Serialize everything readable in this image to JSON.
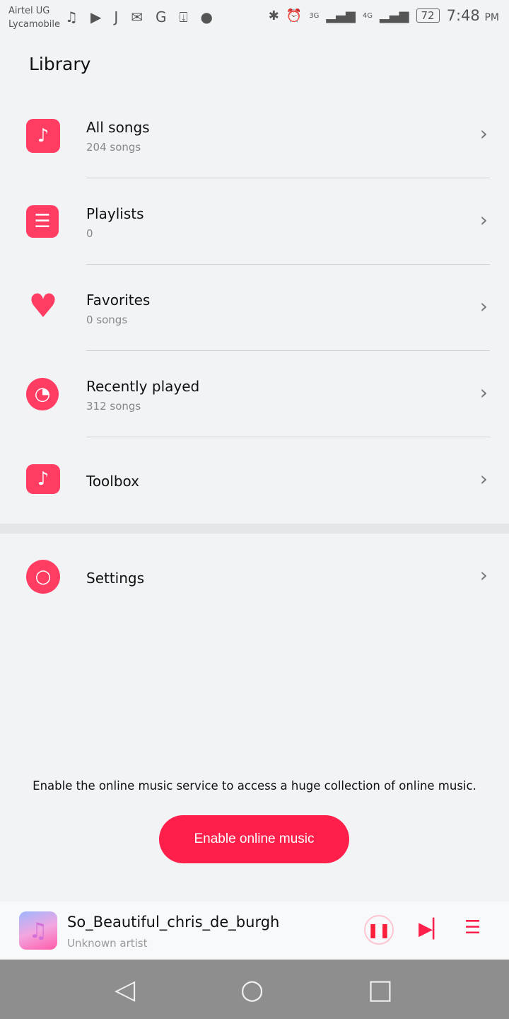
{
  "status": {
    "carrier1": "Airtel UG",
    "carrier2": "Lycamobile",
    "battery": "72",
    "time": "7:48",
    "ampm": "PM",
    "net1": "3G",
    "net2": "4G"
  },
  "header": {
    "title": "Library"
  },
  "items": [
    {
      "label": "All songs",
      "sub": "204 songs",
      "icon": "music-note"
    },
    {
      "label": "Playlists",
      "sub": "0",
      "icon": "playlist"
    },
    {
      "label": "Favorites",
      "sub": "0 songs",
      "icon": "heart"
    },
    {
      "label": "Recently played",
      "sub": "312 songs",
      "icon": "clock"
    },
    {
      "label": "Toolbox",
      "icon": "toolbox"
    }
  ],
  "settings": {
    "label": "Settings",
    "icon": "gear"
  },
  "promo": {
    "text": "Enable the online music service to access a huge collection of online music.",
    "button": "Enable online music"
  },
  "player": {
    "song": "So_Beautiful_chris_de_burgh",
    "artist": "Unknown artist"
  },
  "colors": {
    "accent": "#ff1f4b",
    "background": "#f1f3f5"
  }
}
